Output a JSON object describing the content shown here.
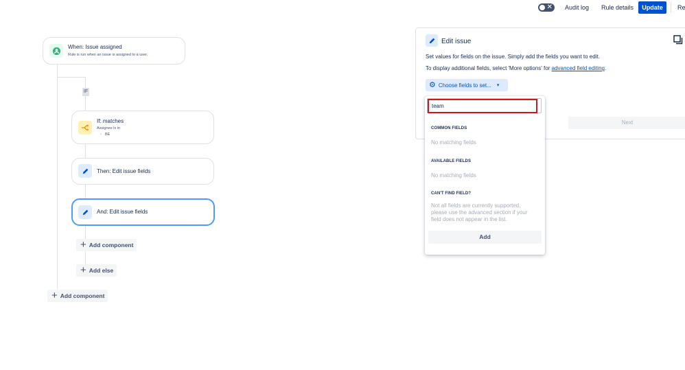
{
  "topbar": {
    "toggle_symbol": "✕",
    "audit_log": "Audit log",
    "rule_details": "Rule details",
    "update": "Update",
    "truncated": "Re"
  },
  "flow": {
    "trigger": {
      "title": "When: Issue assigned",
      "subtitle": "Rule is run when an issue is assigned to a user."
    },
    "if_tag": "IF",
    "condition": {
      "title": "If: matches",
      "line1": "Assignee is in",
      "line2": "BE"
    },
    "then_action": {
      "title": "Then: Edit issue fields"
    },
    "and_action": {
      "title": "And: Edit issue fields"
    },
    "add_component_inner": "Add component",
    "add_else": "Add else",
    "add_component_outer": "Add component"
  },
  "panel": {
    "title": "Edit issue",
    "description1": "Set values for fields on the issue. Simply add the fields you want to edit.",
    "description2_prefix": "To display additional fields, select 'More options' for ",
    "description2_link": "advanced field editing",
    "description2_suffix": ".",
    "choose_fields": "Choose fields to set...",
    "next": "Next"
  },
  "dropdown": {
    "search_value": "team",
    "common_heading": "COMMON FIELDS",
    "common_empty": "No matching fields",
    "available_heading": "AVAILABLE FIELDS",
    "available_empty": "No matching fields",
    "cant_find_heading": "CAN'T FIND FIELD?",
    "cant_find_note": "Not all fields are currently supported, please use the advanced section if your field does not appear in the list.",
    "add": "Add"
  },
  "colors": {
    "primary": "#0052cc",
    "selected_border": "#4c9aff",
    "highlight_box": "#d7141a",
    "trigger_icon": "#36b37e",
    "condition_icon": "#ff8b00"
  },
  "icons": {
    "trigger": "user-check-icon",
    "condition": "branch-icon",
    "edit": "pencil-icon",
    "copy": "copy-icon",
    "gear": "gear-icon"
  }
}
